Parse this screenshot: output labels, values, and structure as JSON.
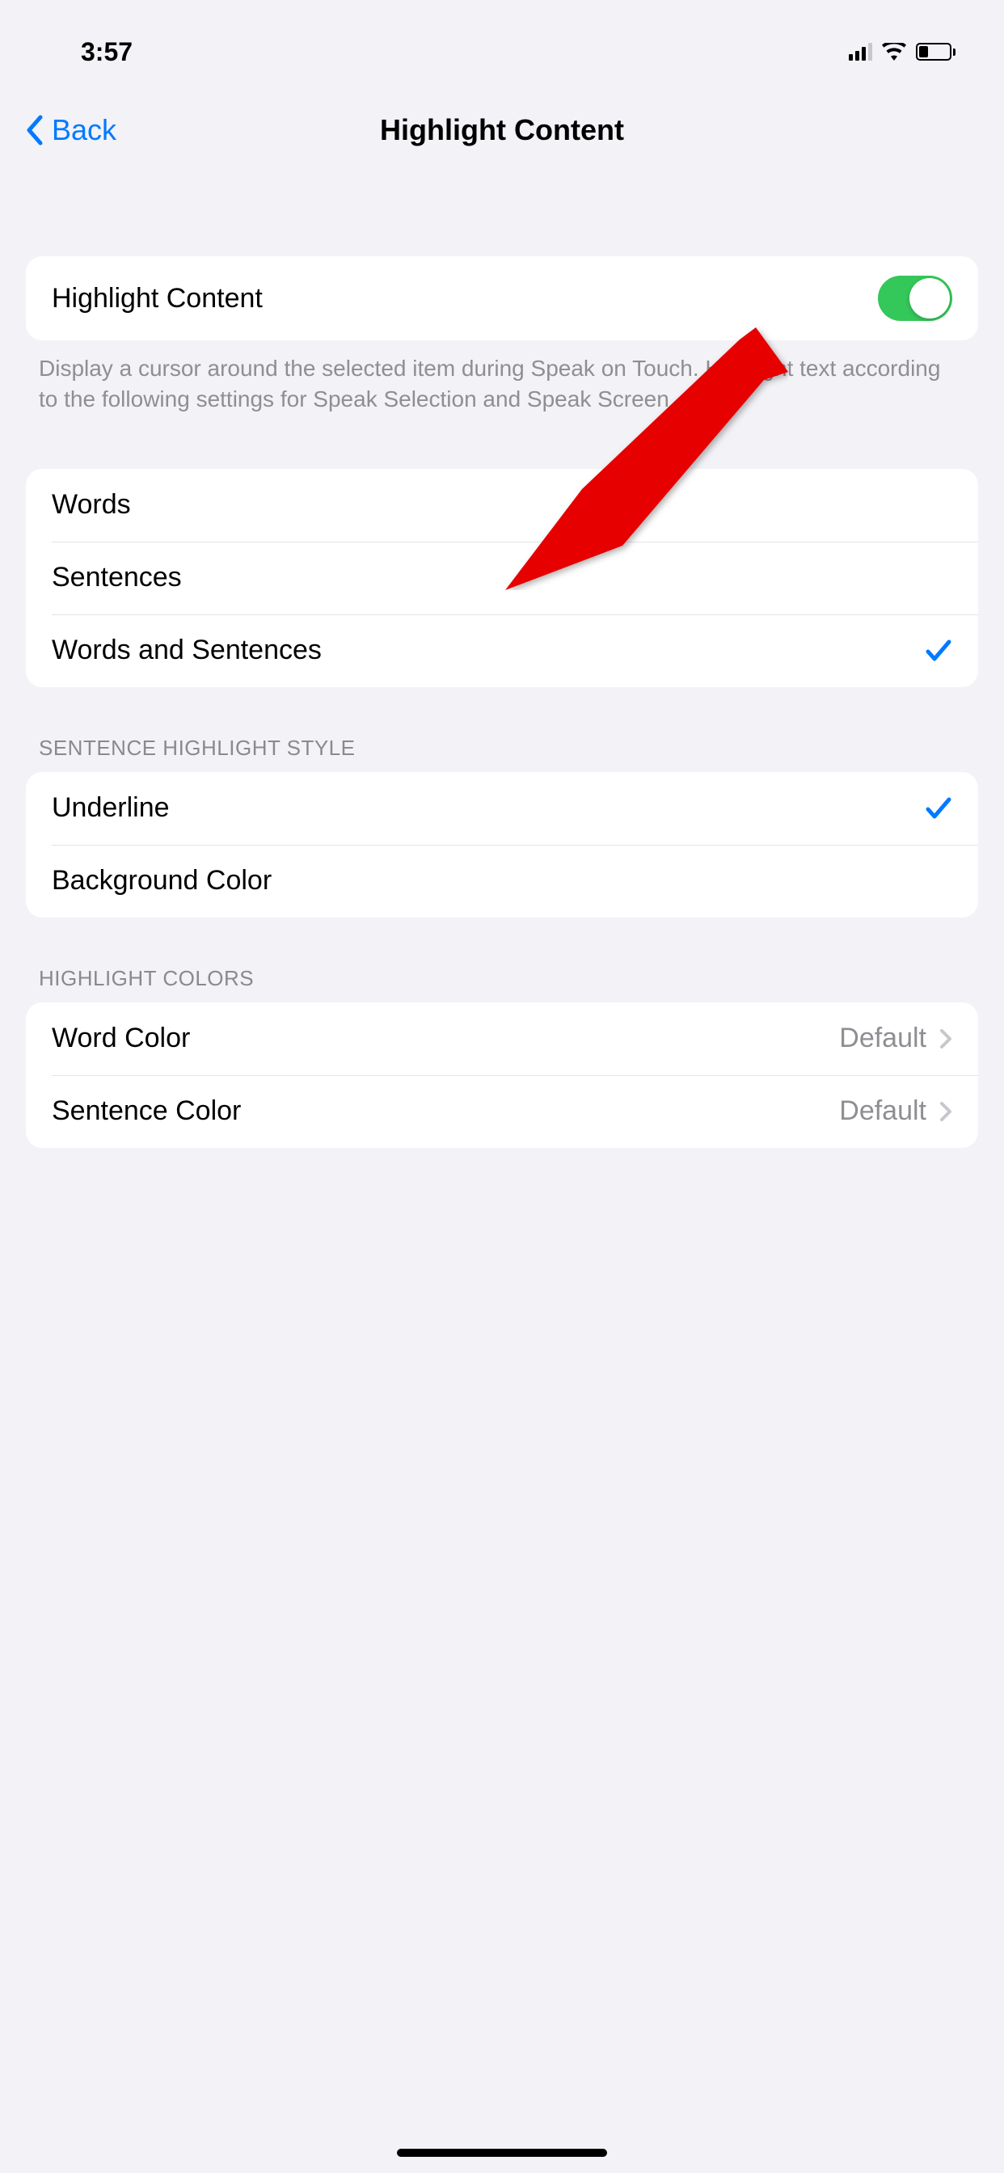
{
  "statusBar": {
    "time": "3:57"
  },
  "nav": {
    "backLabel": "Back",
    "title": "Highlight Content"
  },
  "toggleSection": {
    "label": "Highlight Content",
    "enabled": true,
    "footer": "Display a cursor around the selected item during Speak on Touch. Highlight text according to the following settings for Speak Selection and Speak Screen."
  },
  "highlightMode": {
    "options": [
      {
        "label": "Words",
        "selected": false
      },
      {
        "label": "Sentences",
        "selected": false
      },
      {
        "label": "Words and Sentences",
        "selected": true
      }
    ]
  },
  "sentenceStyle": {
    "header": "SENTENCE HIGHLIGHT STYLE",
    "options": [
      {
        "label": "Underline",
        "selected": true
      },
      {
        "label": "Background Color",
        "selected": false
      }
    ]
  },
  "highlightColors": {
    "header": "HIGHLIGHT COLORS",
    "items": [
      {
        "label": "Word Color",
        "value": "Default"
      },
      {
        "label": "Sentence Color",
        "value": "Default"
      }
    ]
  }
}
